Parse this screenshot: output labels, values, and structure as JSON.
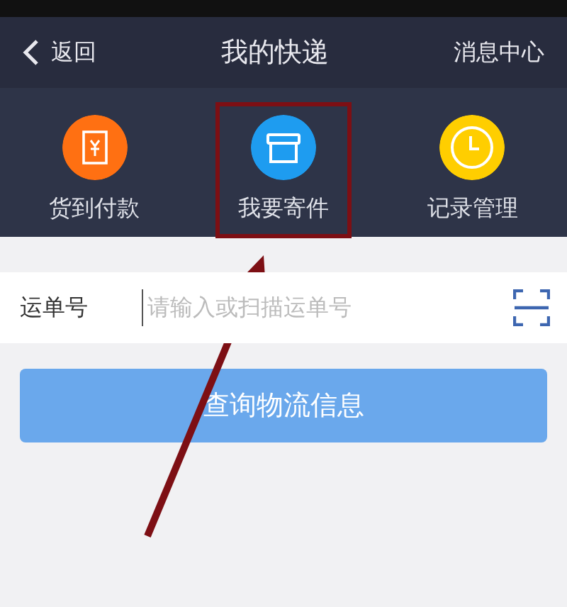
{
  "navbar": {
    "back": "返回",
    "title": "我的快递",
    "action": "消息中心"
  },
  "shortcuts": [
    {
      "label": "货到付款",
      "kind": "yuan",
      "color": "#ff7012",
      "highlighted": false
    },
    {
      "label": "我要寄件",
      "kind": "box",
      "color": "#1e9cf0",
      "highlighted": true
    },
    {
      "label": "记录管理",
      "kind": "clock",
      "color": "#ffce00",
      "highlighted": false
    }
  ],
  "tracking_field": {
    "label": "运单号",
    "placeholder": "请输入或扫描运单号"
  },
  "query_button": {
    "label": "查询物流信息",
    "disabled": true
  },
  "annotation": {
    "kind": "arrow"
  }
}
